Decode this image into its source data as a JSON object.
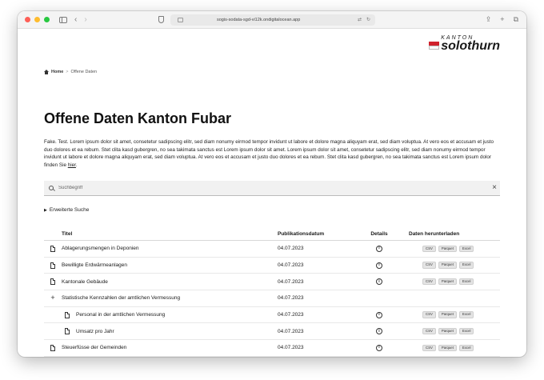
{
  "browser": {
    "url": "sogis-sodata-sgd-vi12k.ondigitalocean.app",
    "traffic_colors": [
      "#fe5f57",
      "#febc2e",
      "#28c840"
    ]
  },
  "logo": {
    "kanton": "KANTON",
    "name": "solothurn",
    "flag_color": "#d0222c"
  },
  "breadcrumb": {
    "home": "Home",
    "separator": ">",
    "current": "Offene Daten"
  },
  "page": {
    "title": "Offene Daten Kanton Fubar",
    "intro": "Fake. Test. Lorem ipsum dolor sit amet, consetetur sadipscing elitr, sed diam nonumy eirmod tempor invidunt ut labore et dolore magna aliquyam erat, sed diam voluptua. At vero eos et accusam et justo duo dolores et ea rebum. Stet clita kasd gubergren, no sea takimata sanctus est Lorem ipsum dolor sit amet. Lorem ipsum dolor sit amet, consetetur sadipscing elitr, sed diam nonumy eirmod tempor invidunt ut labore et dolore magna aliquyam erat, sed diam voluptua. At vero eos et accusam et justo duo dolores et ea rebum. Stet clita kasd gubergren, no sea takimata sanctus est Lorem ipsum dolor finden Sie ",
    "intro_link": "hier",
    "intro_end": "."
  },
  "search": {
    "placeholder": "Suchbegriff",
    "clear": "×"
  },
  "advanced": {
    "label": "Erweiterte Suche"
  },
  "table": {
    "headers": {
      "title": "Titel",
      "date": "Publikationsdatum",
      "details": "Details",
      "download": "Daten herunterladen"
    },
    "rows": [
      {
        "icon": "file-icon",
        "title": "Ablagerungsmengen in Deponien",
        "date": "04.07.2023",
        "details": true,
        "formats": [
          "CSV",
          "Parquet",
          "Excel"
        ],
        "indent": false
      },
      {
        "icon": "file-icon",
        "title": "Bewilligte Erdwärmeanlagen",
        "date": "04.07.2023",
        "details": true,
        "formats": [
          "CSV",
          "Parquet",
          "Excel"
        ],
        "indent": false
      },
      {
        "icon": "file-icon",
        "title": "Kantonale Gebäude",
        "date": "04.07.2023",
        "details": true,
        "formats": [
          "CSV",
          "Parquet",
          "Excel"
        ],
        "indent": false
      },
      {
        "icon": "plus-icon",
        "title": "Statistische Kennzahlen der amtlichen Vermessung",
        "date": "04.07.2023",
        "details": false,
        "formats": [],
        "indent": false
      },
      {
        "icon": "file-icon",
        "title": "Personal in der amtlichen Vermessung",
        "date": "04.07.2023",
        "details": true,
        "formats": [
          "CSV",
          "Parquet",
          "Excel"
        ],
        "indent": true
      },
      {
        "icon": "file-icon",
        "title": "Umsatz pro Jahr",
        "date": "04.07.2023",
        "details": true,
        "formats": [
          "CSV",
          "Parquet",
          "Excel"
        ],
        "indent": true
      },
      {
        "icon": "file-icon",
        "title": "Steuerfüsse der Gemeinden",
        "date": "04.07.2023",
        "details": true,
        "formats": [
          "CSV",
          "Parquet",
          "Excel"
        ],
        "indent": false
      }
    ]
  }
}
